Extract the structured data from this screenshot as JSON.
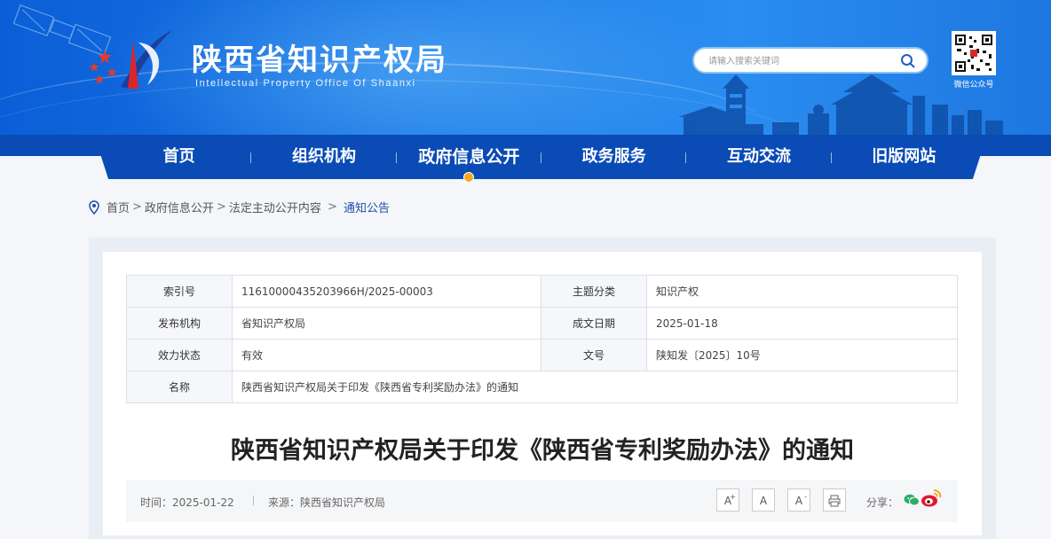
{
  "header": {
    "title": "陕西省知识产权局",
    "subtitle": "Intellectual Property Office Of Shaanxi",
    "search_placeholder": "请输入搜索关键词",
    "qr_label": "微信公众号"
  },
  "nav": {
    "items": [
      {
        "label": "首页"
      },
      {
        "label": "组织机构"
      },
      {
        "label": "政府信息公开"
      },
      {
        "label": "政务服务"
      },
      {
        "label": "互动交流"
      },
      {
        "label": "旧版网站"
      }
    ],
    "active_index": 2
  },
  "breadcrumb": {
    "items": [
      "首页",
      "政府信息公开",
      "法定主动公开内容"
    ],
    "current": "通知公告"
  },
  "meta": {
    "index_label": "索引号",
    "index_value": "11610000435203966H/2025-00003",
    "topic_label": "主题分类",
    "topic_value": "知识产权",
    "publisher_label": "发布机构",
    "publisher_value": "省知识产权局",
    "date_label": "成文日期",
    "date_value": "2025-01-18",
    "status_label": "效力状态",
    "status_value": "有效",
    "docno_label": "文号",
    "docno_value": "陕知发〔2025〕10号",
    "name_label": "名称",
    "name_value": "陕西省知识产权局关于印发《陕西省专利奖励办法》的通知"
  },
  "article": {
    "title": "陕西省知识产权局关于印发《陕西省专利奖励办法》的通知",
    "time": "时间：2025-01-22",
    "source": "来源：陕西省知识产权局",
    "share_label": "分享：",
    "font_increase": "A",
    "font_normal": "A",
    "font_decrease": "A",
    "font_increase_mark": "+",
    "font_decrease_mark": "-"
  },
  "colors": {
    "nav_blue": "#0a4bb5",
    "header_blue": "#1a7be6",
    "breadcrumb_current": "#1f4fa8",
    "active_dot": "#f5a623"
  }
}
